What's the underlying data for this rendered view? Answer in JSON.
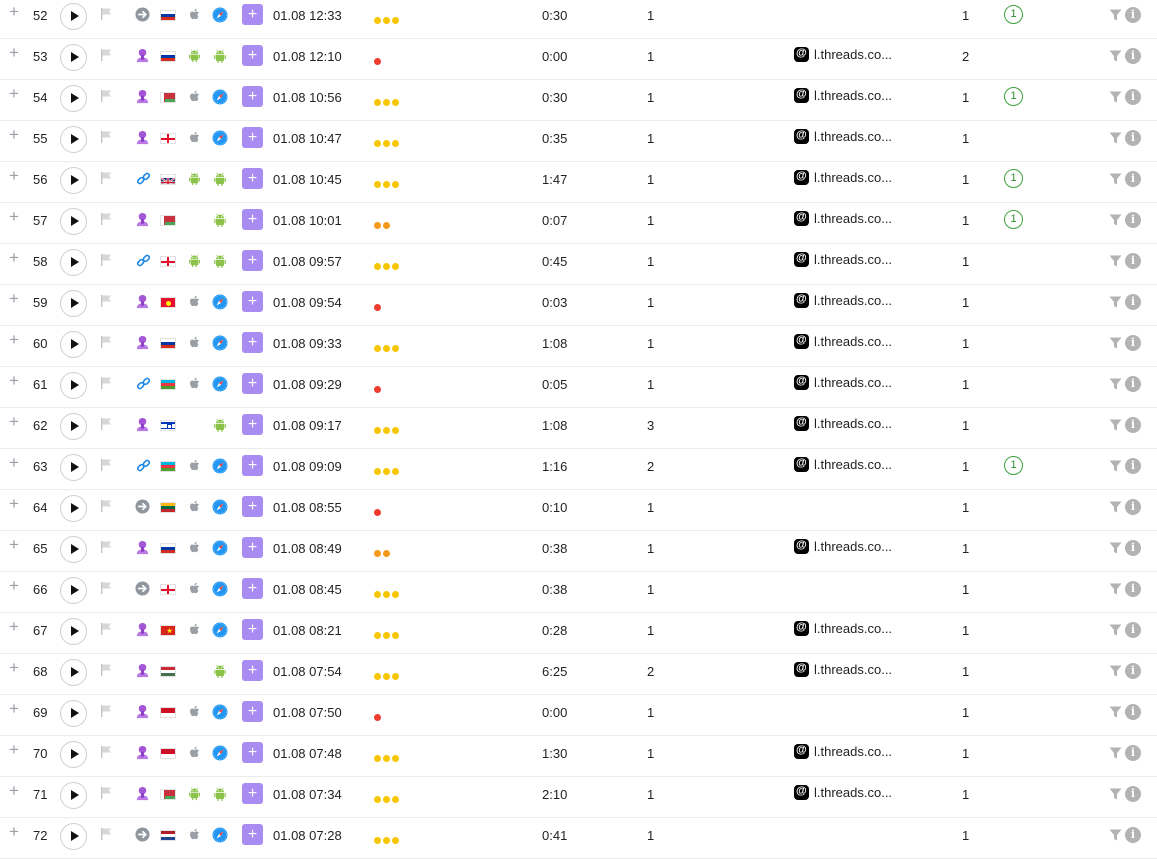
{
  "icons": {
    "expand": "plus-icon",
    "play": "play-icon",
    "flag": "flag-icon",
    "filter": "filter-icon",
    "info": "info-icon",
    "threads": "threads-icon",
    "safari": "safari-icon",
    "apple": "apple-icon",
    "android": "android-icon"
  },
  "glyphs": {
    "expand": "+",
    "add": "+",
    "info": "i"
  },
  "colors": {
    "dot_high": "#f7c600",
    "dot_mid": "#f39a1d",
    "dot_low": "#ef3b2d",
    "accent_purple": "#a98cf2",
    "goal_green": "#3da33d",
    "android_green": "#8bc34a",
    "safari_blue": "#2196f3"
  },
  "rows": [
    {
      "n": "52",
      "source": "direct",
      "country": "ru",
      "os": "ios",
      "browser": "safari",
      "datetime": "01.08 12:33",
      "dots": 3,
      "dot_color": "yellow",
      "duration": "0:30",
      "pages": "1",
      "referrer": "",
      "visits": "1",
      "goal": "1"
    },
    {
      "n": "53",
      "source": "ad",
      "country": "ru",
      "os": "android",
      "browser": "android",
      "datetime": "01.08 12:10",
      "dots": 1,
      "dot_color": "red",
      "duration": "0:00",
      "pages": "1",
      "referrer": "l.threads.co...",
      "visits": "2",
      "goal": ""
    },
    {
      "n": "54",
      "source": "ad",
      "country": "by",
      "os": "ios",
      "browser": "safari",
      "datetime": "01.08 10:56",
      "dots": 3,
      "dot_color": "yellow",
      "duration": "0:30",
      "pages": "1",
      "referrer": "l.threads.co...",
      "visits": "1",
      "goal": "1"
    },
    {
      "n": "55",
      "source": "ad",
      "country": "ge",
      "os": "ios",
      "browser": "safari",
      "datetime": "01.08 10:47",
      "dots": 3,
      "dot_color": "yellow",
      "duration": "0:35",
      "pages": "1",
      "referrer": "l.threads.co...",
      "visits": "1",
      "goal": ""
    },
    {
      "n": "56",
      "source": "referral",
      "country": "gb",
      "os": "android",
      "browser": "android",
      "datetime": "01.08 10:45",
      "dots": 3,
      "dot_color": "yellow",
      "duration": "1:47",
      "pages": "1",
      "referrer": "l.threads.co...",
      "visits": "1",
      "goal": "1"
    },
    {
      "n": "57",
      "source": "ad",
      "country": "by",
      "os": "",
      "browser": "android",
      "datetime": "01.08 10:01",
      "dots": 2,
      "dot_color": "orange",
      "duration": "0:07",
      "pages": "1",
      "referrer": "l.threads.co...",
      "visits": "1",
      "goal": "1"
    },
    {
      "n": "58",
      "source": "referral",
      "country": "ge",
      "os": "android",
      "browser": "android",
      "datetime": "01.08 09:57",
      "dots": 3,
      "dot_color": "yellow",
      "duration": "0:45",
      "pages": "1",
      "referrer": "l.threads.co...",
      "visits": "1",
      "goal": ""
    },
    {
      "n": "59",
      "source": "ad",
      "country": "kg",
      "os": "ios",
      "browser": "safari",
      "datetime": "01.08 09:54",
      "dots": 1,
      "dot_color": "red",
      "duration": "0:03",
      "pages": "1",
      "referrer": "l.threads.co...",
      "visits": "1",
      "goal": ""
    },
    {
      "n": "60",
      "source": "ad",
      "country": "ru",
      "os": "ios",
      "browser": "safari",
      "datetime": "01.08 09:33",
      "dots": 3,
      "dot_color": "yellow",
      "duration": "1:08",
      "pages": "1",
      "referrer": "l.threads.co...",
      "visits": "1",
      "goal": ""
    },
    {
      "n": "61",
      "source": "referral",
      "country": "az",
      "os": "ios",
      "browser": "safari",
      "datetime": "01.08 09:29",
      "dots": 1,
      "dot_color": "red",
      "duration": "0:05",
      "pages": "1",
      "referrer": "l.threads.co...",
      "visits": "1",
      "goal": ""
    },
    {
      "n": "62",
      "source": "ad",
      "country": "il",
      "os": "",
      "browser": "android",
      "datetime": "01.08 09:17",
      "dots": 3,
      "dot_color": "yellow",
      "duration": "1:08",
      "pages": "3",
      "referrer": "l.threads.co...",
      "visits": "1",
      "goal": ""
    },
    {
      "n": "63",
      "source": "referral",
      "country": "az",
      "os": "ios",
      "browser": "safari",
      "datetime": "01.08 09:09",
      "dots": 3,
      "dot_color": "yellow",
      "duration": "1:16",
      "pages": "2",
      "referrer": "l.threads.co...",
      "visits": "1",
      "goal": "1"
    },
    {
      "n": "64",
      "source": "direct",
      "country": "lt",
      "os": "ios",
      "browser": "safari",
      "datetime": "01.08 08:55",
      "dots": 1,
      "dot_color": "red",
      "duration": "0:10",
      "pages": "1",
      "referrer": "",
      "visits": "1",
      "goal": ""
    },
    {
      "n": "65",
      "source": "ad",
      "country": "ru",
      "os": "ios",
      "browser": "safari",
      "datetime": "01.08 08:49",
      "dots": 2,
      "dot_color": "orange",
      "duration": "0:38",
      "pages": "1",
      "referrer": "l.threads.co...",
      "visits": "1",
      "goal": ""
    },
    {
      "n": "66",
      "source": "direct",
      "country": "ge",
      "os": "ios",
      "browser": "safari",
      "datetime": "01.08 08:45",
      "dots": 3,
      "dot_color": "yellow",
      "duration": "0:38",
      "pages": "1",
      "referrer": "",
      "visits": "1",
      "goal": ""
    },
    {
      "n": "67",
      "source": "ad",
      "country": "vn",
      "os": "ios",
      "browser": "safari",
      "datetime": "01.08 08:21",
      "dots": 3,
      "dot_color": "yellow",
      "duration": "0:28",
      "pages": "1",
      "referrer": "l.threads.co...",
      "visits": "1",
      "goal": ""
    },
    {
      "n": "68",
      "source": "ad",
      "country": "hu",
      "os": "",
      "browser": "android",
      "datetime": "01.08 07:54",
      "dots": 3,
      "dot_color": "yellow",
      "duration": "6:25",
      "pages": "2",
      "referrer": "l.threads.co...",
      "visits": "1",
      "goal": ""
    },
    {
      "n": "69",
      "source": "ad",
      "country": "id",
      "os": "ios",
      "browser": "safari",
      "datetime": "01.08 07:50",
      "dots": 1,
      "dot_color": "red",
      "duration": "0:00",
      "pages": "1",
      "referrer": "",
      "visits": "1",
      "goal": ""
    },
    {
      "n": "70",
      "source": "ad",
      "country": "id",
      "os": "ios",
      "browser": "safari",
      "datetime": "01.08 07:48",
      "dots": 3,
      "dot_color": "yellow",
      "duration": "1:30",
      "pages": "1",
      "referrer": "l.threads.co...",
      "visits": "1",
      "goal": ""
    },
    {
      "n": "71",
      "source": "ad",
      "country": "by",
      "os": "android",
      "browser": "android",
      "datetime": "01.08 07:34",
      "dots": 3,
      "dot_color": "yellow",
      "duration": "2:10",
      "pages": "1",
      "referrer": "l.threads.co...",
      "visits": "1",
      "goal": ""
    },
    {
      "n": "72",
      "source": "direct",
      "country": "nl",
      "os": "ios",
      "browser": "safari",
      "datetime": "01.08 07:28",
      "dots": 3,
      "dot_color": "yellow",
      "duration": "0:41",
      "pages": "1",
      "referrer": "",
      "visits": "1",
      "goal": ""
    }
  ]
}
